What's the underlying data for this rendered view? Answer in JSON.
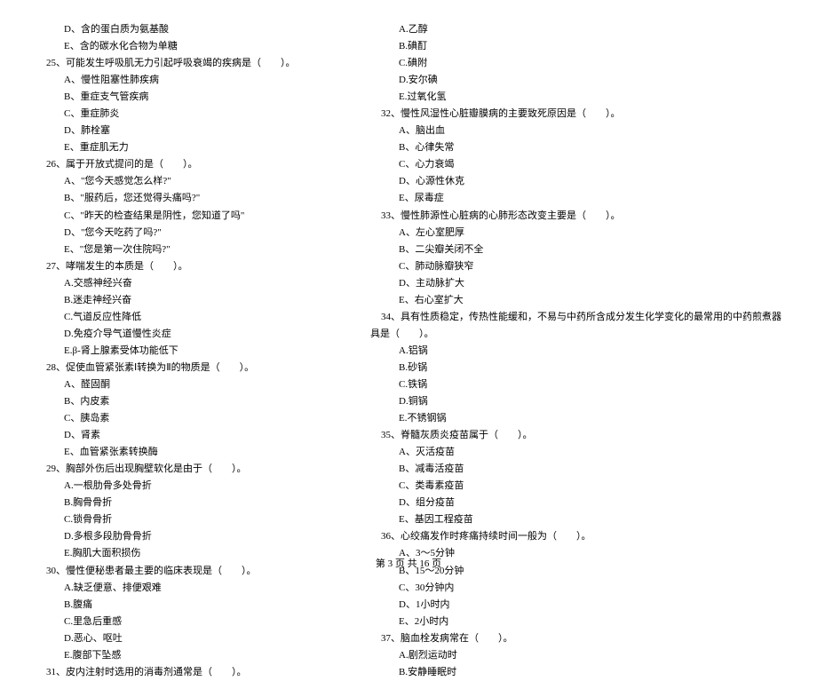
{
  "left_column": [
    {
      "cls": "indent-1",
      "text": "D、含的蛋白质为氨基酸"
    },
    {
      "cls": "indent-1",
      "text": "E、含的碳水化合物为单糖"
    },
    {
      "cls": "q-num",
      "text": "25、可能发生呼吸肌无力引起呼吸衰竭的疾病是（　　）。"
    },
    {
      "cls": "indent-1",
      "text": "A、慢性阻塞性肺疾病"
    },
    {
      "cls": "indent-1",
      "text": "B、重症支气管疾病"
    },
    {
      "cls": "indent-1",
      "text": "C、重症肺炎"
    },
    {
      "cls": "indent-1",
      "text": "D、肺栓塞"
    },
    {
      "cls": "indent-1",
      "text": "E、重症肌无力"
    },
    {
      "cls": "q-num",
      "text": "26、属于开放式提问的是（　　）。"
    },
    {
      "cls": "indent-1",
      "text": "A、\"您今天感觉怎么样?\""
    },
    {
      "cls": "indent-1",
      "text": "B、\"服药后，您还觉得头痛吗?\""
    },
    {
      "cls": "indent-1",
      "text": "C、\"昨天的检查结果是阴性，您知道了吗\""
    },
    {
      "cls": "indent-1",
      "text": "D、\"您今天吃药了吗?\""
    },
    {
      "cls": "indent-1",
      "text": "E、\"您是第一次住院吗?\""
    },
    {
      "cls": "q-num",
      "text": "27、哮喘发生的本质是（　　）。"
    },
    {
      "cls": "indent-1",
      "text": "A.交感神经兴奋"
    },
    {
      "cls": "indent-1",
      "text": "B.迷走神经兴奋"
    },
    {
      "cls": "indent-1",
      "text": "C.气道反应性降低"
    },
    {
      "cls": "indent-1",
      "text": "D.免疫介导气道慢性炎症"
    },
    {
      "cls": "indent-1",
      "text": "E.β-肾上腺素受体功能低下"
    },
    {
      "cls": "q-num",
      "text": "28、促使血管紧张素Ⅰ转换为Ⅱ的物质是（　　）。"
    },
    {
      "cls": "indent-1",
      "text": "A、醛固酮"
    },
    {
      "cls": "indent-1",
      "text": "B、内皮素"
    },
    {
      "cls": "indent-1",
      "text": "C、胰岛素"
    },
    {
      "cls": "indent-1",
      "text": "D、肾素"
    },
    {
      "cls": "indent-1",
      "text": "E、血管紧张素转换酶"
    },
    {
      "cls": "q-num",
      "text": "29、胸部外伤后出现胸壁软化是由于（　　）。"
    },
    {
      "cls": "indent-1",
      "text": "A.一根肋骨多处骨折"
    },
    {
      "cls": "indent-1",
      "text": "B.胸骨骨折"
    },
    {
      "cls": "indent-1",
      "text": "C.锁骨骨折"
    },
    {
      "cls": "indent-1",
      "text": "D.多根多段肋骨骨折"
    },
    {
      "cls": "indent-1",
      "text": "E.胸肌大面积损伤"
    },
    {
      "cls": "q-num",
      "text": "30、慢性便秘患者最主要的临床表现是（　　）。"
    },
    {
      "cls": "indent-1",
      "text": "A.缺乏便意、排便艰难"
    },
    {
      "cls": "indent-1",
      "text": "B.腹痛"
    },
    {
      "cls": "indent-1",
      "text": "C.里急后重感"
    },
    {
      "cls": "indent-1",
      "text": "D.恶心、呕吐"
    },
    {
      "cls": "indent-1",
      "text": "E.腹部下坠感"
    },
    {
      "cls": "q-num",
      "text": "31、皮内注射时选用的消毒剂通常是（　　）。"
    }
  ],
  "right_column": [
    {
      "cls": "indent-1",
      "text": "A.乙醇"
    },
    {
      "cls": "indent-1",
      "text": "B.碘酊"
    },
    {
      "cls": "indent-1",
      "text": "C.碘附"
    },
    {
      "cls": "indent-1",
      "text": "D.安尔碘"
    },
    {
      "cls": "indent-1",
      "text": "E.过氧化氢"
    },
    {
      "cls": "q-num",
      "text": "32、慢性风湿性心脏瓣膜病的主要致死原因是（　　）。"
    },
    {
      "cls": "indent-1",
      "text": "A、脑出血"
    },
    {
      "cls": "indent-1",
      "text": "B、心律失常"
    },
    {
      "cls": "indent-1",
      "text": "C、心力衰竭"
    },
    {
      "cls": "indent-1",
      "text": "D、心源性休克"
    },
    {
      "cls": "indent-1",
      "text": "E、尿毒症"
    },
    {
      "cls": "q-num",
      "text": "33、慢性肺源性心脏病的心肺形态改变主要是（　　）。"
    },
    {
      "cls": "indent-1",
      "text": "A、左心室肥厚"
    },
    {
      "cls": "indent-1",
      "text": "B、二尖瓣关闭不全"
    },
    {
      "cls": "indent-1",
      "text": "C、肺动脉瓣狭窄"
    },
    {
      "cls": "indent-1",
      "text": "D、主动脉扩大"
    },
    {
      "cls": "indent-1",
      "text": "E、右心室扩大"
    },
    {
      "cls": "q-num",
      "text": "34、具有性质稳定，传热性能缓和，不易与中药所含成分发生化学变化的最常用的中药煎煮器"
    },
    {
      "cls": "continuation",
      "text": "具是（　　）。"
    },
    {
      "cls": "indent-1",
      "text": "A.铝锅"
    },
    {
      "cls": "indent-1",
      "text": "B.砂锅"
    },
    {
      "cls": "indent-1",
      "text": "C.铁锅"
    },
    {
      "cls": "indent-1",
      "text": "D.铜锅"
    },
    {
      "cls": "indent-1",
      "text": "E.不锈钢锅"
    },
    {
      "cls": "q-num",
      "text": "35、脊髓灰质炎疫苗属于（　　）。"
    },
    {
      "cls": "indent-1",
      "text": "A、灭活疫苗"
    },
    {
      "cls": "indent-1",
      "text": "B、减毒活疫苗"
    },
    {
      "cls": "indent-1",
      "text": "C、类毒素疫苗"
    },
    {
      "cls": "indent-1",
      "text": "D、组分疫苗"
    },
    {
      "cls": "indent-1",
      "text": "E、基因工程疫苗"
    },
    {
      "cls": "q-num",
      "text": "36、心绞痛发作时疼痛持续时间一般为（　　）。"
    },
    {
      "cls": "indent-1",
      "text": "A、3～5分钟"
    },
    {
      "cls": "indent-1",
      "text": "B、15～20分钟"
    },
    {
      "cls": "indent-1",
      "text": "C、30分钟内"
    },
    {
      "cls": "indent-1",
      "text": "D、1小时内"
    },
    {
      "cls": "indent-1",
      "text": "E、2小时内"
    },
    {
      "cls": "q-num",
      "text": "37、脑血栓发病常在（　　）。"
    },
    {
      "cls": "indent-1",
      "text": "A.剧烈运动时"
    },
    {
      "cls": "indent-1",
      "text": "B.安静睡眠时"
    }
  ],
  "footer": "第 3 页 共 16 页"
}
